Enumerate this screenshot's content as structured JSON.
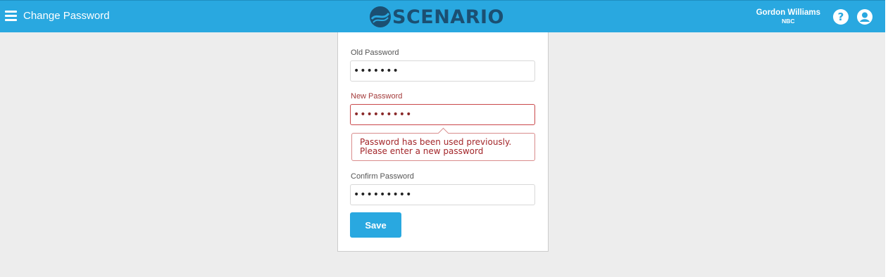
{
  "header": {
    "title": "Change Password",
    "logo_text": "SCENARIO",
    "user_name": "Gordon Williams",
    "user_org": "NBC",
    "menu_icon": "hamburger-menu-icon",
    "help_icon": "question-circle-icon",
    "account_icon": "user-circle-icon"
  },
  "form": {
    "old_password": {
      "label": "Old Password",
      "value": "•••••••"
    },
    "new_password": {
      "label": "New Password",
      "value": "•••••••••",
      "error_line1": "Password has been used previously.",
      "error_line2": "Please enter a new password"
    },
    "confirm_password": {
      "label": "Confirm Password",
      "value": "•••••••••"
    },
    "save_label": "Save"
  },
  "colors": {
    "header_bg": "#29a8e0",
    "logo": "#1b4f72",
    "error": "#a3262a",
    "page_bg": "#ededed"
  }
}
